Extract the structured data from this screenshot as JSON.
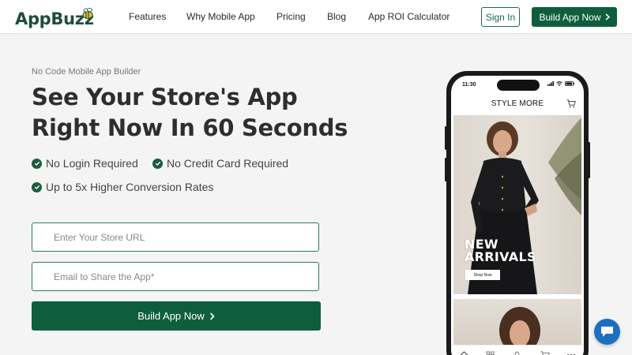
{
  "header": {
    "logo_text": "AppBuzz",
    "nav": [
      "Features",
      "Why Mobile App",
      "Pricing",
      "Blog",
      "App ROI Calculator"
    ],
    "sign_in": "Sign In",
    "build_app": "Build App Now"
  },
  "hero": {
    "eyebrow": "No Code Mobile App Builder",
    "headline": "See Your Store's App Right Now In 60 Seconds",
    "features": [
      "No Login Required",
      "No Credit Card Required",
      "Up to 5x Higher Conversion Rates"
    ],
    "store_url_placeholder": "Enter Your Store URL",
    "email_placeholder": "Email to Share the App*",
    "cta": "Build App Now"
  },
  "phone": {
    "time": "11:30",
    "store_title": "STYLE MORE",
    "banner_line1": "NEW",
    "banner_line2": "ARRIVALS",
    "shop_now": "Shop Now",
    "tabs": [
      "home-icon",
      "grid-icon",
      "profile-icon",
      "cart-icon",
      "more-icon"
    ]
  },
  "colors": {
    "brand_green": "#0e5e3e",
    "chat_blue": "#1e6fbf"
  }
}
